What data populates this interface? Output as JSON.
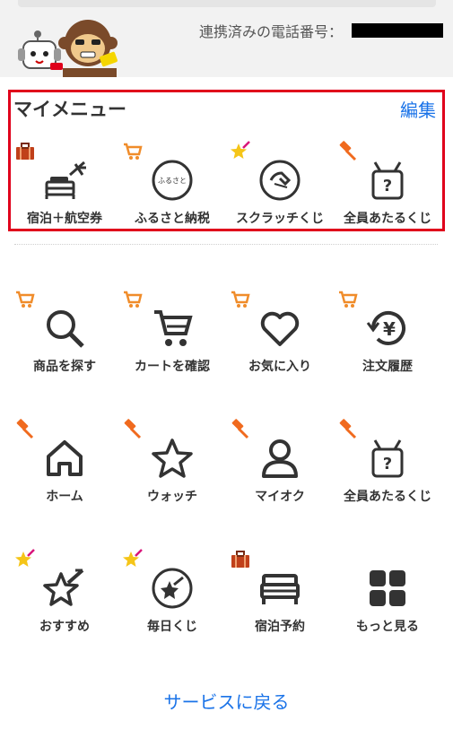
{
  "header": {
    "phone_label": "連携済みの電話番号："
  },
  "mymenu": {
    "title": "マイメニュー",
    "edit_label": "編集",
    "items": [
      {
        "label": "宿泊＋航空券",
        "icon": "bed-plane-icon",
        "badge": "suitcase-badge"
      },
      {
        "label": "ふるさと納税",
        "icon": "furusato-icon",
        "badge": "cart-badge",
        "icon_text": "ふるさと"
      },
      {
        "label": "スクラッチくじ",
        "icon": "scratch-icon",
        "badge": "star-badge"
      },
      {
        "label": "全員あたるくじ",
        "icon": "lottery-box-icon",
        "badge": "auction-badge"
      }
    ]
  },
  "menu": {
    "items": [
      {
        "label": "商品を探す",
        "icon": "search-icon",
        "badge": "cart-badge"
      },
      {
        "label": "カートを確認",
        "icon": "cart-icon",
        "badge": "cart-badge"
      },
      {
        "label": "お気に入り",
        "icon": "heart-icon",
        "badge": "cart-badge"
      },
      {
        "label": "注文履歴",
        "icon": "yen-history-icon",
        "badge": "cart-badge"
      },
      {
        "label": "ホーム",
        "icon": "home-icon",
        "badge": "auction-badge"
      },
      {
        "label": "ウォッチ",
        "icon": "star-icon",
        "badge": "auction-badge"
      },
      {
        "label": "マイオク",
        "icon": "person-icon",
        "badge": "auction-badge"
      },
      {
        "label": "全員あたるくじ",
        "icon": "lottery-box-icon",
        "badge": "auction-badge"
      },
      {
        "label": "おすすめ",
        "icon": "recommend-star-icon",
        "badge": "star-badge"
      },
      {
        "label": "毎日くじ",
        "icon": "daily-lottery-icon",
        "badge": "star-badge"
      },
      {
        "label": "宿泊予約",
        "icon": "bed-icon",
        "badge": "suitcase-badge"
      },
      {
        "label": "もっと見る",
        "icon": "grid-icon",
        "badge": ""
      }
    ]
  },
  "footer": {
    "back_label": "サービスに戻る"
  },
  "colors": {
    "accent_red": "#e0001b",
    "link_blue": "#1a73e8",
    "icon_dark": "#333333",
    "cart_orange": "#f08c2a",
    "auction_orange": "#f06a1e",
    "star_yellow": "#f5c518"
  }
}
